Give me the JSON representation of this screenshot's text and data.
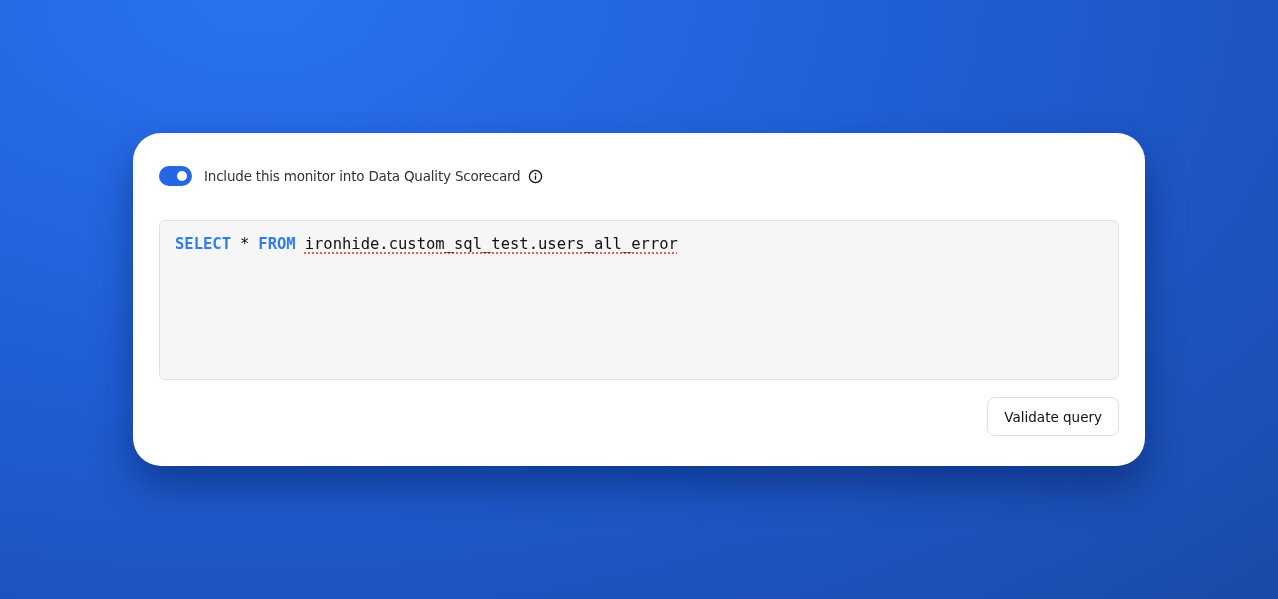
{
  "scorecard_toggle": {
    "on": true,
    "label": "Include this monitor into Data Quality Scorecard"
  },
  "query_editor": {
    "tokens": [
      {
        "text": "SELECT",
        "kind": "keyword",
        "error": false
      },
      {
        "text": "*",
        "kind": "operator",
        "error": false
      },
      {
        "text": "FROM",
        "kind": "keyword",
        "error": false
      },
      {
        "text": "ironhide.custom_sql_test.users_all_error",
        "kind": "identifier",
        "error": true
      }
    ]
  },
  "buttons": [
    "Validate query"
  ]
}
